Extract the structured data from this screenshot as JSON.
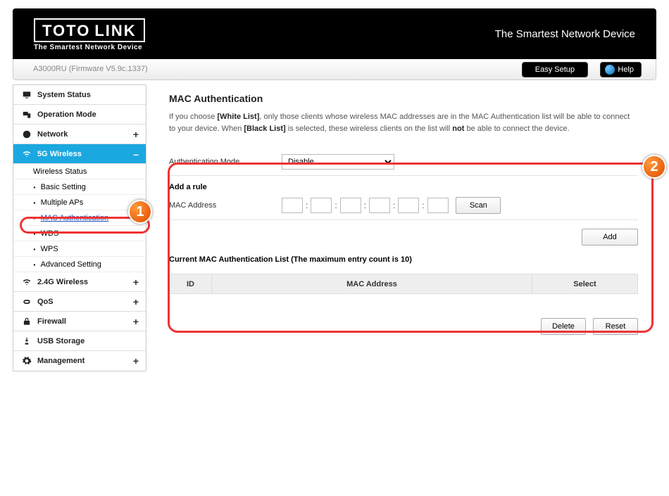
{
  "header": {
    "brand_left": "TOTO",
    "brand_right": "LINK",
    "brand_sub": "The Smartest Network Device",
    "tagline": "The Smartest Network Device"
  },
  "bar": {
    "device": "A3000RU (Firmware V5.9c.1337)",
    "easy_setup": "Easy Setup",
    "help": "Help"
  },
  "sidebar": {
    "system_status": "System Status",
    "operation_mode": "Operation Mode",
    "network": "Network",
    "wl5": "5G Wireless",
    "wl5_sub": {
      "status": "Wireless Status",
      "basic": "Basic Setting",
      "multiap": "Multiple APs",
      "macauth": "MAC Authentication",
      "wds": "WDS",
      "wps": "WPS",
      "adv": "Advanced Setting"
    },
    "wl24": "2.4G Wireless",
    "qos": "QoS",
    "firewall": "Firewall",
    "usb": "USB Storage",
    "mgmt": "Management",
    "expand": "+",
    "collapse": "–"
  },
  "content": {
    "title": "MAC Authentication",
    "desc_pre": "If you choose ",
    "desc_white": "[White List]",
    "desc_mid": ", only those clients whose wireless MAC addresses are in the MAC Authentication list will be able to connect to your device. When ",
    "desc_black": "[Black List]",
    "desc_mid2": " is selected, these wireless clients on the list will ",
    "desc_not": "not",
    "desc_post": " be able to connect the device.",
    "auth_mode_lbl": "Authentication Mode",
    "auth_mode_val": "Disable",
    "add_rule": "Add a rule",
    "mac_lbl": "MAC Address",
    "scan": "Scan",
    "add": "Add",
    "list_title": "Current MAC Authentication List (The maximum entry count is 10)",
    "col_id": "ID",
    "col_mac": "MAC Address",
    "col_sel": "Select",
    "delete": "Delete",
    "reset": "Reset"
  },
  "annotations": {
    "b1": "1",
    "b2": "2"
  }
}
